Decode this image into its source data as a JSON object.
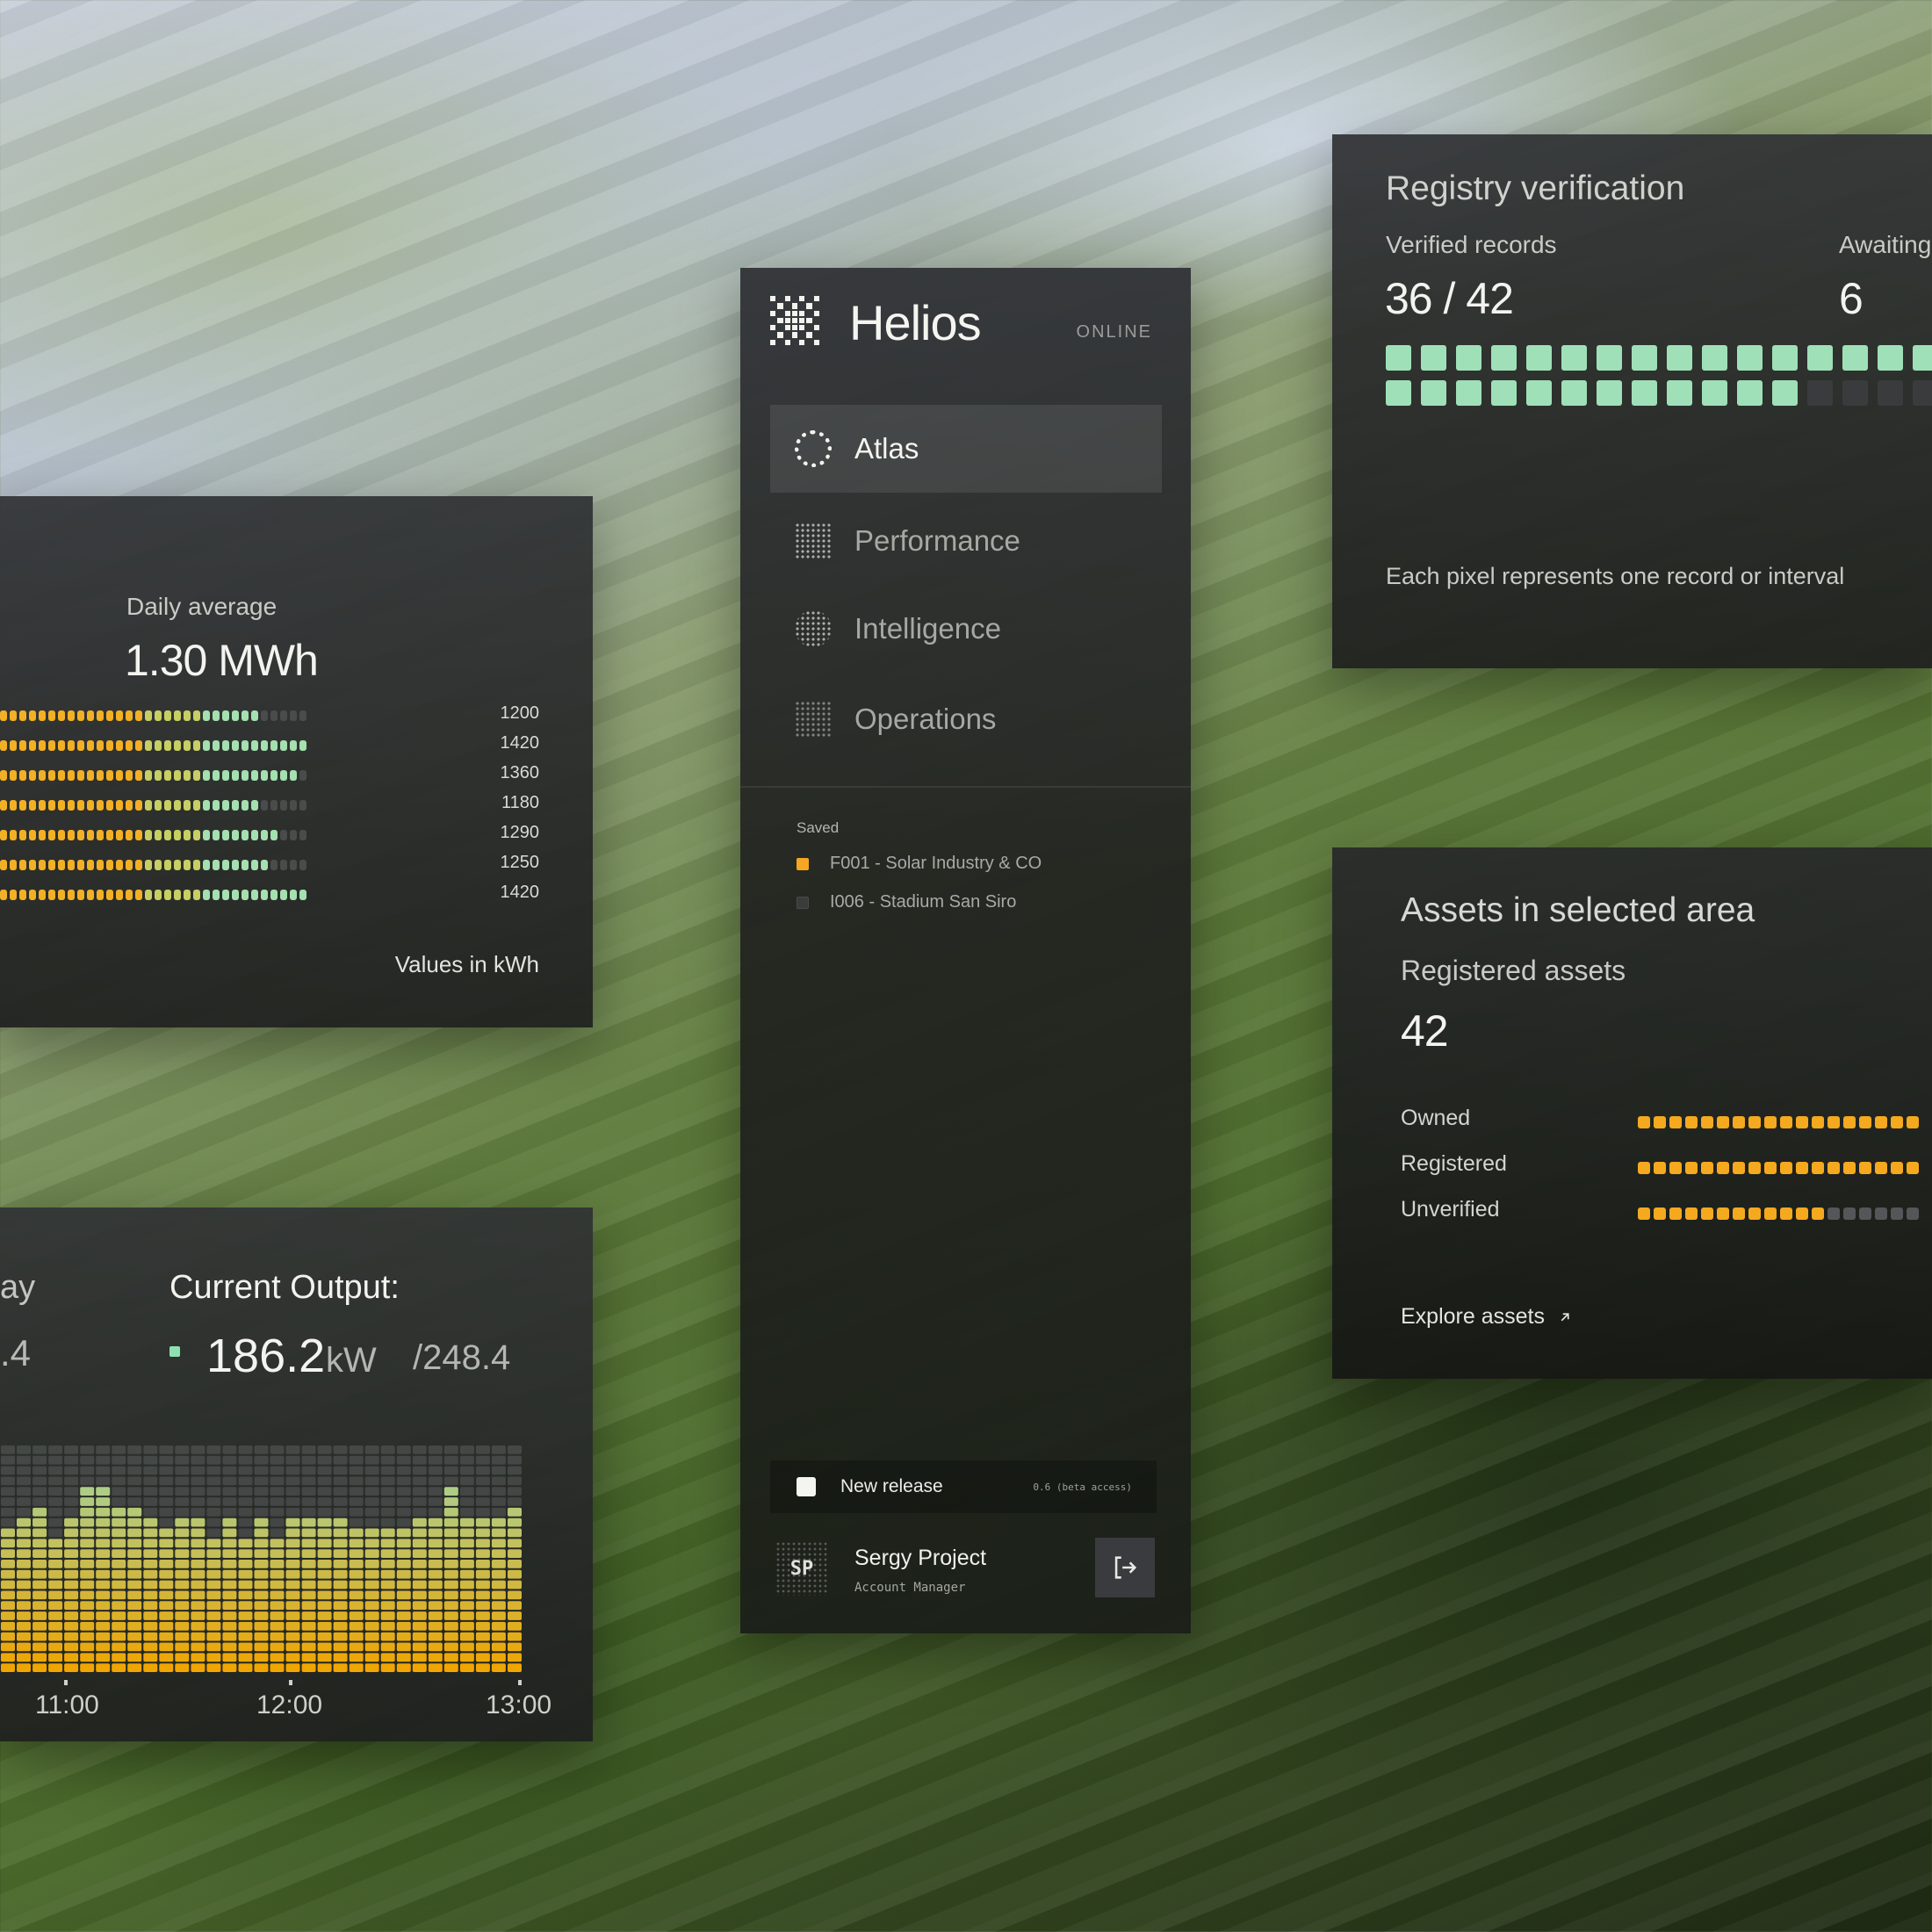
{
  "sidebar": {
    "app_title": "Helios",
    "status": "ONLINE",
    "nav": [
      {
        "label": "Atlas",
        "icon": "atlas-ring-icon",
        "active": true
      },
      {
        "label": "Performance",
        "icon": "performance-grid-icon",
        "active": false
      },
      {
        "label": "Intelligence",
        "icon": "intelligence-dots-icon",
        "active": false
      },
      {
        "label": "Operations",
        "icon": "operations-list-icon",
        "active": false
      }
    ],
    "saved_title": "Saved",
    "saved": [
      {
        "label": "F001 - Solar Industry & CO",
        "color": "#f5a623",
        "selected": true
      },
      {
        "label": "I006 - Stadium San Siro",
        "color": "#3a3b3a",
        "selected": false
      }
    ],
    "release": {
      "label": "New release",
      "version": "0.6 (beta access)"
    },
    "user": {
      "initials": "SP",
      "name": "Sergy Project",
      "role": "Account Manager"
    }
  },
  "daily": {
    "label": "Daily average",
    "value": "1.30 MWh",
    "rows": [
      {
        "value": "1200",
        "amount": 1200
      },
      {
        "value": "1420",
        "amount": 1420
      },
      {
        "value": "1360",
        "amount": 1360
      },
      {
        "value": "1180",
        "amount": 1180
      },
      {
        "value": "1290",
        "amount": 1290
      },
      {
        "value": "1250",
        "amount": 1250
      },
      {
        "value": "1420",
        "amount": 1420
      }
    ],
    "max": 1420,
    "note": "Values in kWh"
  },
  "output": {
    "prev_title": "ay",
    "prev_value": ".4",
    "title": "Current Output:",
    "value": "186.2",
    "unit": "kW",
    "max": "/248.4",
    "ticks": [
      "11:00",
      "12:00",
      "13:00"
    ],
    "levels": [
      0.62,
      0.7,
      0.72,
      0.6,
      0.68,
      0.8,
      0.8,
      0.72,
      0.72,
      0.68,
      0.62,
      0.68,
      0.68,
      0.58,
      0.68,
      0.58,
      0.7,
      0.58,
      0.7,
      0.66,
      0.7,
      0.68,
      0.64,
      0.64,
      0.62,
      0.62,
      0.66,
      0.68,
      0.8,
      0.7,
      0.7,
      0.68,
      0.72
    ],
    "colors": {
      "top": "#9fd6a4",
      "bottom": "#f0a500"
    }
  },
  "registry": {
    "title": "Registry verification",
    "verified_label": "Verified records",
    "verified_value": "36 / 42",
    "awaiting_label": "Awaiting",
    "awaiting_value": "6",
    "verified_count": 36,
    "total": 42,
    "note": "Each pixel represents one record or interval",
    "colors": {
      "on": "#9fe0b8",
      "off": "#3a3b3d"
    }
  },
  "assets": {
    "title": "Assets in selected area",
    "registered_label": "Registered assets",
    "registered_value": "42",
    "rows": [
      {
        "label": "Owned",
        "fill": 1.0
      },
      {
        "label": "Registered",
        "fill": 1.0
      },
      {
        "label": "Unverified",
        "fill": 0.68
      }
    ],
    "link": "Explore assets",
    "colors": {
      "on": "#f5a91e",
      "off": "#55565a"
    }
  }
}
